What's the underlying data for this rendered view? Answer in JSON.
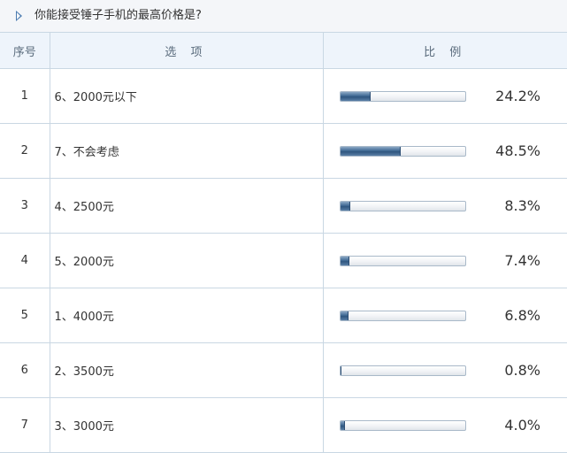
{
  "question": {
    "text": "你能接受锤子手机的最高价格是?"
  },
  "table": {
    "headers": {
      "index": "序号",
      "option": "选 项",
      "ratio": "比 例"
    },
    "rows": [
      {
        "index": "1",
        "option": "6、2000元以下",
        "percent_label": "24.2%",
        "fill": 24.2
      },
      {
        "index": "2",
        "option": "7、不会考虑",
        "percent_label": "48.5%",
        "fill": 48.5
      },
      {
        "index": "3",
        "option": "4、2500元",
        "percent_label": "8.3%",
        "fill": 8.3
      },
      {
        "index": "4",
        "option": "5、2000元",
        "percent_label": "7.4%",
        "fill": 7.4
      },
      {
        "index": "5",
        "option": "1、4000元",
        "percent_label": "6.8%",
        "fill": 6.8
      },
      {
        "index": "6",
        "option": "2、3500元",
        "percent_label": "0.8%",
        "fill": 0.8
      },
      {
        "index": "7",
        "option": "3、3000元",
        "percent_label": "4.0%",
        "fill": 4.0
      }
    ]
  }
}
